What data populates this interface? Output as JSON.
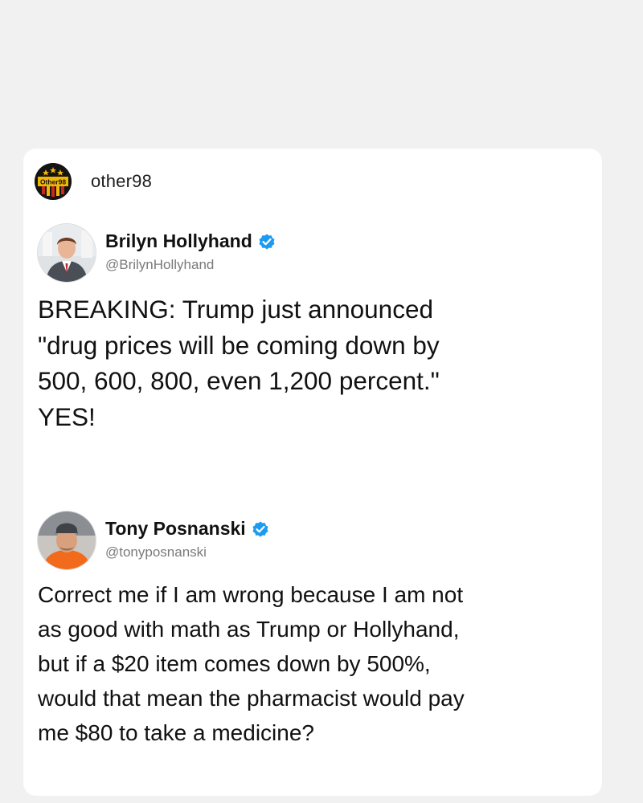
{
  "source": {
    "name": "other98",
    "logo_text": "Other98",
    "logo_icon": "other98-logo"
  },
  "tweets": [
    {
      "display_name": "Brilyn Hollyhand",
      "handle": "@BrilynHollyhand",
      "verified_icon": "verified-badge-icon",
      "avatar_icon": "profile-photo",
      "text_lines": [
        "BREAKING: Trump just announced",
        "\"drug prices will be coming down by",
        "500, 600, 800, even 1,200 percent.\"",
        "YES!"
      ]
    },
    {
      "display_name": "Tony Posnanski",
      "handle": "@tonyposnanski",
      "verified_icon": "verified-badge-icon",
      "avatar_icon": "profile-photo",
      "text_lines": [
        "Correct me if I am wrong because I am not",
        "as good with math as Trump or Hollyhand,",
        "but if a $20 item comes down by 500%,",
        "would that mean the pharmacist would pay",
        "me $80 to take a medicine?"
      ]
    }
  ],
  "colors": {
    "background": "#f1f1f1",
    "card": "#ffffff",
    "verified": "#1d9bf0",
    "handle": "#7a7a7a"
  }
}
